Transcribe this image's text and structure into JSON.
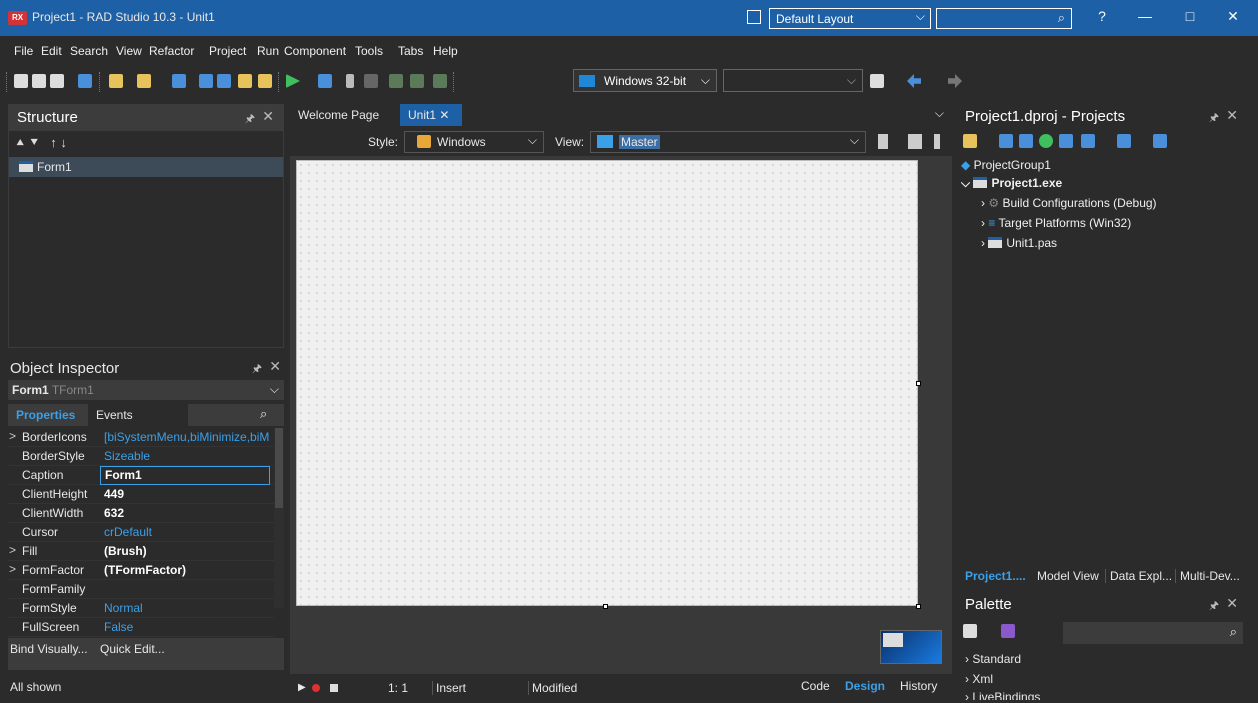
{
  "title": {
    "logo": "RX",
    "text": "Project1 - RAD Studio 10.3 - Unit1",
    "layout_value": "Default Layout",
    "help": "?",
    "min": "—",
    "max": "□",
    "close": "✕"
  },
  "menu": [
    "File",
    "Edit",
    "Search",
    "View",
    "Refactor",
    "Project",
    "Run",
    "Component",
    "Tools",
    "Tabs",
    "Help"
  ],
  "toolbar": {
    "platform": "Windows 32-bit",
    "config": ""
  },
  "structure": {
    "title": "Structure",
    "item": "Form1"
  },
  "inspector": {
    "title": "Object Inspector",
    "object": "Form1",
    "object_type": "TForm1",
    "tab_properties": "Properties",
    "tab_events": "Events",
    "rows": [
      {
        "expand": ">",
        "name": "BorderIcons",
        "value": "[biSystemMenu,biMinimize,biM",
        "style": "blue"
      },
      {
        "expand": "",
        "name": "BorderStyle",
        "value": "Sizeable",
        "style": "blue"
      },
      {
        "expand": "",
        "name": "Caption",
        "value": "Form1",
        "style": "bold"
      },
      {
        "expand": "",
        "name": "ClientHeight",
        "value": "449",
        "style": "bold"
      },
      {
        "expand": "",
        "name": "ClientWidth",
        "value": "632",
        "style": "bold"
      },
      {
        "expand": "",
        "name": "Cursor",
        "value": "crDefault",
        "style": "blue"
      },
      {
        "expand": ">",
        "name": "Fill",
        "value": "(Brush)",
        "style": "bold"
      },
      {
        "expand": ">",
        "name": "FormFactor",
        "value": "(TFormFactor)",
        "style": "bold"
      },
      {
        "expand": "",
        "name": "FormFamily",
        "value": "",
        "style": "blue"
      },
      {
        "expand": "",
        "name": "FormStyle",
        "value": "Normal",
        "style": "blue"
      },
      {
        "expand": "",
        "name": "FullScreen",
        "value": "False",
        "style": "blue"
      }
    ],
    "bind": "Bind Visually...",
    "quick": "Quick Edit...",
    "status": "All shown"
  },
  "editor": {
    "tab_welcome": "Welcome Page",
    "tab_unit": "Unit1",
    "style_label": "Style:",
    "style_value": "Windows",
    "view_label": "View:",
    "view_value": "Master",
    "pos": "1:   1",
    "mode": "Insert",
    "modified": "Modified",
    "tab_code": "Code",
    "tab_design": "Design",
    "tab_history": "History"
  },
  "projects": {
    "title": "Project1.dproj - Projects",
    "group": "ProjectGroup1",
    "project": "Project1.exe",
    "build": "Build Configurations (Debug)",
    "target": "Target Platforms (Win32)",
    "unit": "Unit1.pas",
    "tabs": [
      "Project1....",
      "Model View",
      "Data Expl...",
      "Multi-Dev..."
    ]
  },
  "palette": {
    "title": "Palette",
    "items": [
      "Standard",
      "Xml",
      "LiveBindings"
    ]
  },
  "colors": {
    "accent": "#1e60a5",
    "selection": "#3d4a57",
    "blue_value": "#3aa0e8"
  }
}
